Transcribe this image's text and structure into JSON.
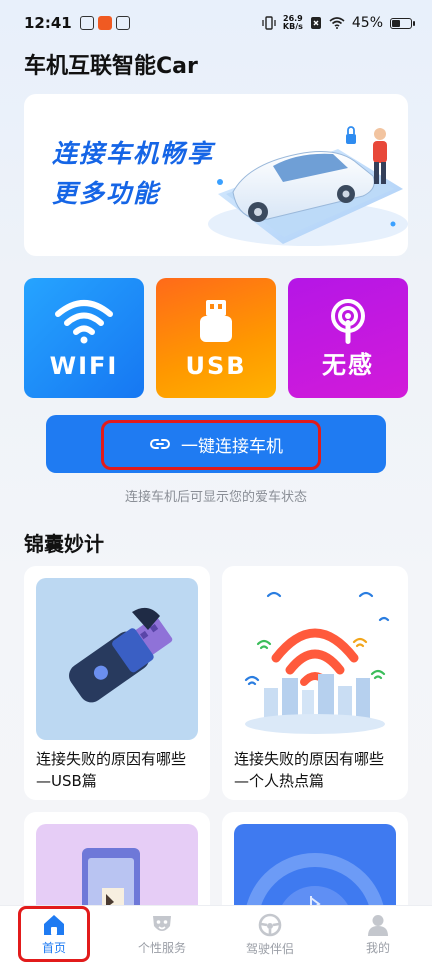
{
  "status_bar": {
    "time": "12:41",
    "net_speed_value": "26.9",
    "net_speed_unit": "KB/s",
    "battery": "45%",
    "battery_level": 0.45
  },
  "header": {
    "title": "车机互联智能Car"
  },
  "banner": {
    "line1": "连接车机畅享",
    "line2": "更多功能"
  },
  "tiles": [
    {
      "label": "WIFI",
      "icon": "wifi-icon",
      "color": "#1f86f5"
    },
    {
      "label": "USB",
      "icon": "usb-icon",
      "color": "#ff8a10"
    },
    {
      "label": "无感",
      "icon": "sensor-icon",
      "color": "#c419e0"
    }
  ],
  "connect": {
    "button_label": "一键连接车机",
    "hint": "连接车机后可显示您的爱车状态"
  },
  "tips": {
    "title": "锦囊妙计",
    "cards": [
      {
        "title": "连接失败的原因有哪些—USB篇"
      },
      {
        "title": "连接失败的原因有哪些—个人热点篇"
      },
      {
        "title": ""
      },
      {
        "title": ""
      }
    ]
  },
  "bottom_nav": {
    "items": [
      {
        "label": "首页",
        "icon": "home-icon",
        "active": true
      },
      {
        "label": "个性服务",
        "icon": "mask-icon",
        "active": false
      },
      {
        "label": "驾驶伴侣",
        "icon": "steering-wheel-icon",
        "active": false
      },
      {
        "label": "我的",
        "icon": "person-icon",
        "active": false
      }
    ]
  },
  "colors": {
    "accent": "#1f7bf2",
    "highlight_outline": "#e21b1b"
  }
}
